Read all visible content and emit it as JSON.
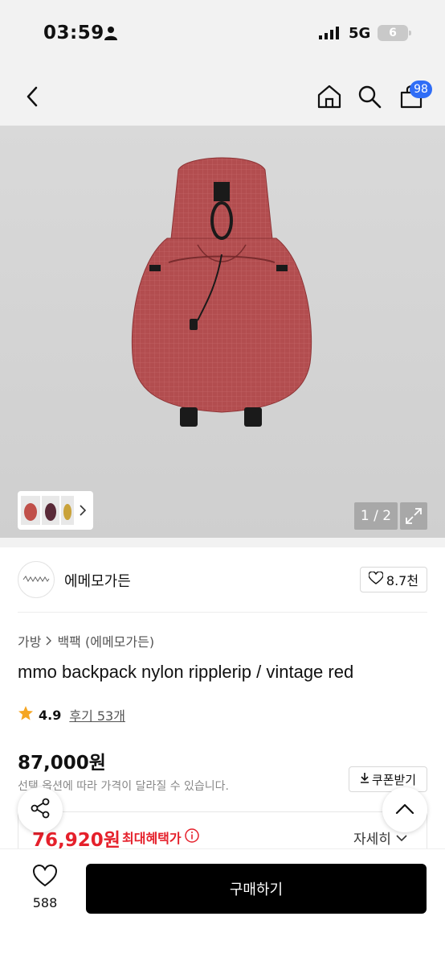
{
  "status_bar": {
    "time": "03:59",
    "network": "5G",
    "battery": "6"
  },
  "nav": {
    "cart_count": "98"
  },
  "gallery": {
    "pager": "1 / 2"
  },
  "brand": {
    "name": "에메모가든",
    "likes": "8.7천"
  },
  "product": {
    "breadcrumb": [
      "가방",
      "백팩 (에메모가든)"
    ],
    "title": "mmo backpack nylon ripplerip / vintage red",
    "rating": "4.9",
    "reviews": "후기 53개",
    "price": "87,000원",
    "price_note": "선택 옵션에 따라 가격이 달라질 수 있습니다.",
    "coupon_label": "쿠폰받기",
    "benefit_price": "76,920원",
    "benefit_label": "최대혜택가",
    "detail_label": "자세히"
  },
  "bottom_bar": {
    "wish_count": "588",
    "buy_label": "구매하기"
  },
  "colors": {
    "accent_red": "#e5202b",
    "badge_blue": "#2f6df6",
    "bag_red": "#b04a4c"
  },
  "icons": [
    "person-icon",
    "signal-icon",
    "back-icon",
    "home-icon",
    "search-icon",
    "cart-icon",
    "expand-icon",
    "chevron-right-icon",
    "heart-icon",
    "star-icon",
    "download-icon",
    "info-icon",
    "chevron-down-icon",
    "share-icon",
    "chevron-up-icon"
  ]
}
